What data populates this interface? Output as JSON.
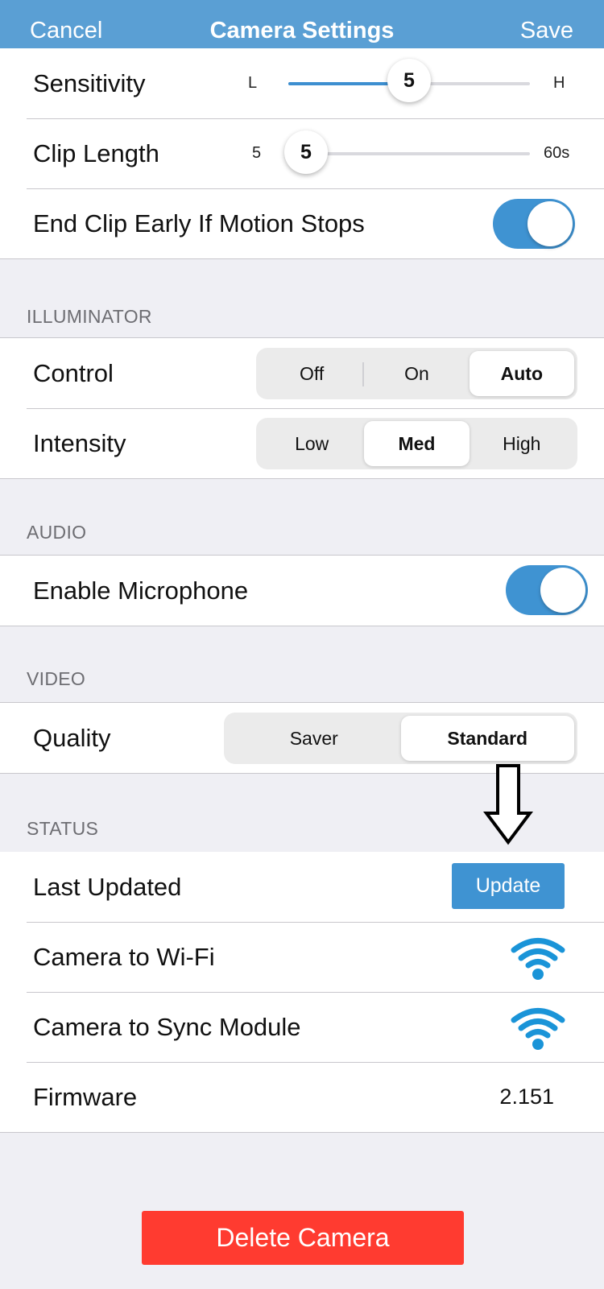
{
  "navbar": {
    "cancel": "Cancel",
    "title": "Camera Settings",
    "save": "Save"
  },
  "motion": {
    "sensitivity": {
      "label": "Sensitivity",
      "min_label": "L",
      "max_label": "H",
      "value": "5",
      "fraction": 0.5
    },
    "clip_length": {
      "label": "Clip Length",
      "min_label": "5",
      "max_label": "60s",
      "value": "5",
      "fraction": 0.0
    },
    "end_clip_early": {
      "label": "End Clip Early If Motion Stops",
      "on": true
    }
  },
  "illuminator": {
    "header": "ILLUMINATOR",
    "control": {
      "label": "Control",
      "options": [
        "Off",
        "On",
        "Auto"
      ],
      "selected": "Auto"
    },
    "intensity": {
      "label": "Intensity",
      "options": [
        "Low",
        "Med",
        "High"
      ],
      "selected": "Med"
    }
  },
  "audio": {
    "header": "AUDIO",
    "microphone": {
      "label": "Enable Microphone",
      "on": true
    }
  },
  "video": {
    "header": "VIDEO",
    "quality": {
      "label": "Quality",
      "options": [
        "Saver",
        "Standard"
      ],
      "selected": "Standard"
    }
  },
  "status": {
    "header": "STATUS",
    "last_updated": {
      "label": "Last Updated",
      "button": "Update"
    },
    "wifi": {
      "label": "Camera to Wi-Fi",
      "icon": "wifi-icon"
    },
    "sync_module": {
      "label": "Camera to Sync Module",
      "icon": "wifi-icon"
    },
    "firmware": {
      "label": "Firmware",
      "value": "2.151"
    }
  },
  "delete_button": "Delete Camera",
  "colors": {
    "nav": "#5a9fd4",
    "accent": "#3f93d2",
    "danger": "#ff3b30"
  }
}
